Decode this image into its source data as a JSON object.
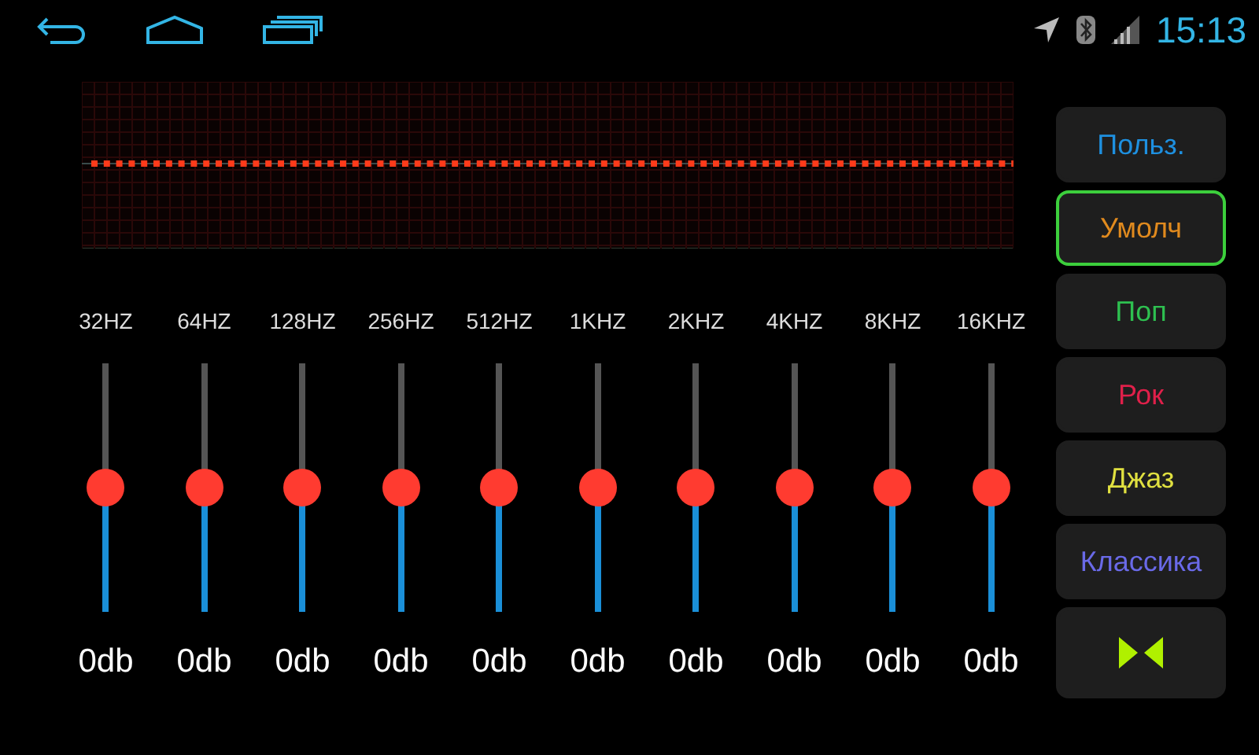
{
  "status_bar": {
    "time": "15:13"
  },
  "bands": [
    {
      "label": "32HZ",
      "level": 0.5,
      "reading": "0db"
    },
    {
      "label": "64HZ",
      "level": 0.5,
      "reading": "0db"
    },
    {
      "label": "128HZ",
      "level": 0.5,
      "reading": "0db"
    },
    {
      "label": "256HZ",
      "level": 0.5,
      "reading": "0db"
    },
    {
      "label": "512HZ",
      "level": 0.5,
      "reading": "0db"
    },
    {
      "label": "1KHZ",
      "level": 0.5,
      "reading": "0db"
    },
    {
      "label": "2KHZ",
      "level": 0.5,
      "reading": "0db"
    },
    {
      "label": "4KHZ",
      "level": 0.5,
      "reading": "0db"
    },
    {
      "label": "8KHZ",
      "level": 0.5,
      "reading": "0db"
    },
    {
      "label": "16KHZ",
      "level": 0.5,
      "reading": "0db"
    }
  ],
  "presets": [
    {
      "label": "Польз.",
      "selected": false
    },
    {
      "label": "Умолч",
      "selected": true
    },
    {
      "label": "Поп",
      "selected": false
    },
    {
      "label": "Рок",
      "selected": false
    },
    {
      "label": "Джаз",
      "selected": false
    },
    {
      "label": "Классика",
      "selected": false
    }
  ]
}
